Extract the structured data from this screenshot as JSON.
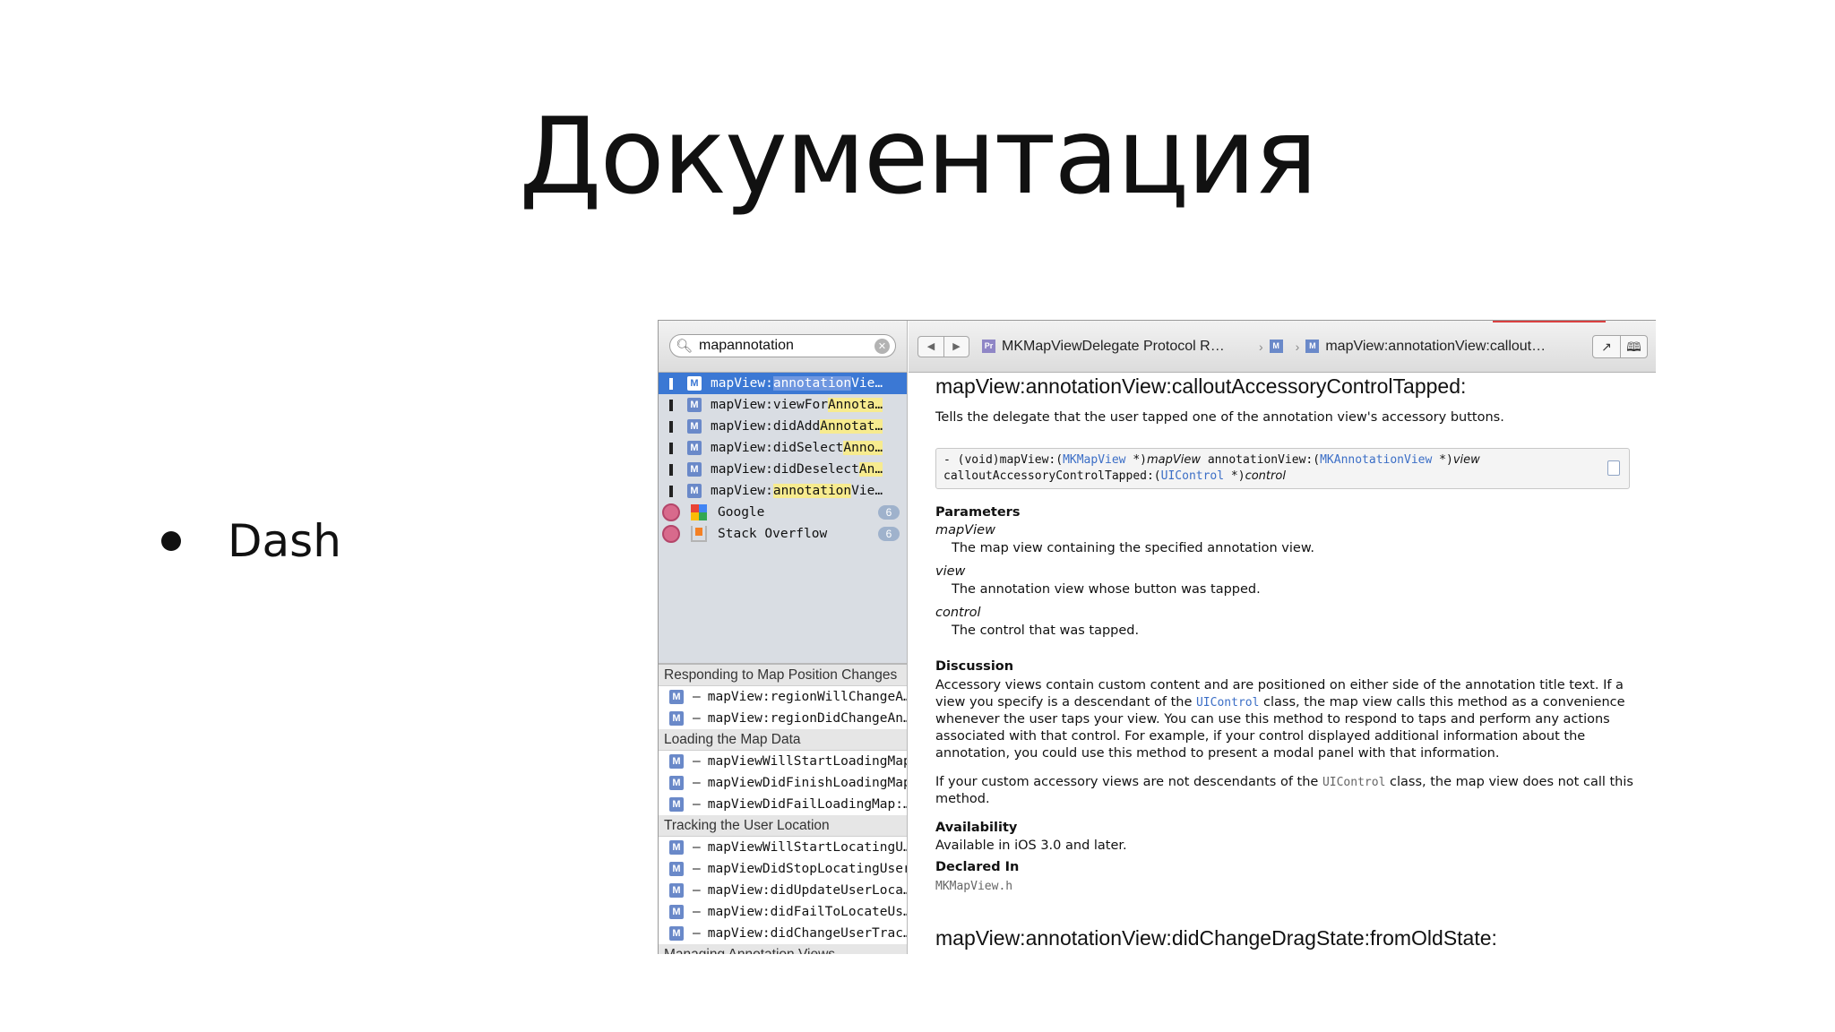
{
  "slide": {
    "title": "Документация",
    "bullet": "Dash"
  },
  "sidebar": {
    "search_value": "mapannotation",
    "results": [
      {
        "pre": "mapView:",
        "hl": "annotation",
        "post": "View…",
        "selected": true
      },
      {
        "pre": "mapView:viewFor",
        "hl": "Annotat",
        "post": "…",
        "selected": false
      },
      {
        "pre": "mapView:didAdd",
        "hl": "Annotati",
        "post": "…",
        "selected": false
      },
      {
        "pre": "mapView:didSelect",
        "hl": "Annot",
        "post": "…",
        "selected": false
      },
      {
        "pre": "mapView:didDeselect",
        "hl": "Ann",
        "post": "…",
        "selected": false
      },
      {
        "pre": "mapView:",
        "hl": "annotation",
        "post": "View…",
        "selected": false
      }
    ],
    "web": [
      {
        "label": "Google",
        "count": "6"
      },
      {
        "label": "Stack Overflow",
        "count": "6"
      }
    ],
    "toc": [
      {
        "header": "Responding to Map Position Changes",
        "items": [
          "mapView:regionWillChangeA…",
          "mapView:regionDidChangeAn…"
        ]
      },
      {
        "header": "Loading the Map Data",
        "items": [
          "mapViewWillStartLoadingMap:",
          "mapViewDidFinishLoadingMap:",
          "mapViewDidFailLoadingMap:…"
        ]
      },
      {
        "header": "Tracking the User Location",
        "items": [
          "mapViewWillStartLocatingU…",
          "mapViewDidStopLocatingUser:",
          "mapView:didUpdateUserLoca…",
          "mapView:didFailToLocateUs…",
          "mapView:didChangeUserTrac…"
        ]
      },
      {
        "header": "Managing Annotation Views",
        "items": []
      }
    ]
  },
  "toolbar": {
    "crumb1": "MKMapViewDelegate Protocol R…",
    "crumb3": "mapView:annotationView:callout…"
  },
  "doc": {
    "title": "mapView:annotationView:calloutAccessoryControlTapped:",
    "abstract": "Tells the delegate that the user tapped one of the annotation view's accessory buttons.",
    "decl": {
      "l1a": "- (void)mapView:(",
      "t1": "MKMapView",
      "l1b": " *)",
      "a1": "mapView",
      "l1c": " annotationView:(",
      "t2": "MKAnnotationView",
      "l1d": " *)",
      "a2": "view",
      "l2a": "calloutAccessoryControlTapped:(",
      "t3": "UIControl",
      "l2b": " *)",
      "a3": "control"
    },
    "parameters_head": "Parameters",
    "params": [
      {
        "name": "mapView",
        "desc": "The map view containing the specified annotation view."
      },
      {
        "name": "view",
        "desc": "The annotation view whose button was tapped."
      },
      {
        "name": "control",
        "desc": "The control that was tapped."
      }
    ],
    "discussion_head": "Discussion",
    "disc1a": "Accessory views contain custom content and are positioned on either side of the annotation title text. If a view you specify is a descendant of the ",
    "disc1_code": "UIControl",
    "disc1b": " class, the map view calls this method as a convenience whenever the user taps your view. You can use this method to respond to taps and perform any actions associated with that control. For example, if your control displayed additional information about the annotation, you could use this method to present a modal panel with that information.",
    "disc2a": "If your custom accessory views are not descendants of the ",
    "disc2_code": "UIControl",
    "disc2b": " class, the map view does not call this method.",
    "availability_head": "Availability",
    "availability": "Available in iOS 3.0 and later.",
    "declared_head": "Declared In",
    "declared": "MKMapView.h",
    "next_title": "mapView:annotationView:didChangeDragState:fromOldState:"
  }
}
